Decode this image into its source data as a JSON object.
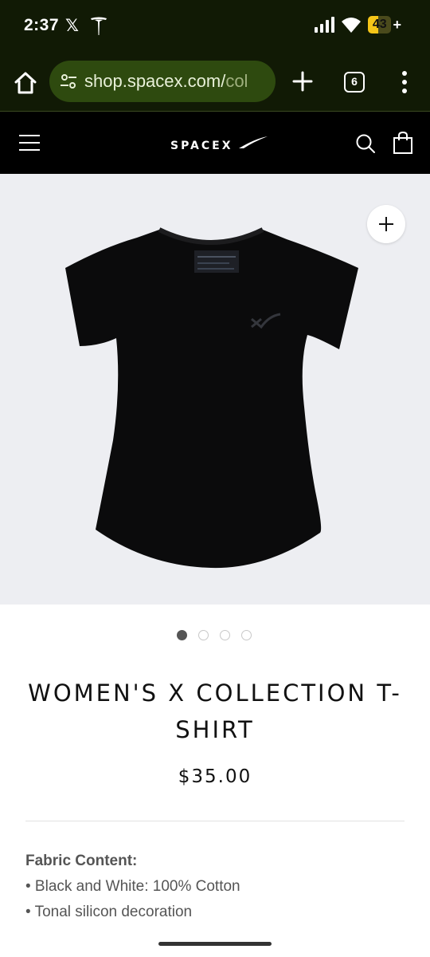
{
  "status_bar": {
    "time": "2:37",
    "x_glyph": "𝕏",
    "battery_level": "43",
    "battery_fill_percent": 43,
    "accent_color": "#f5c518"
  },
  "browser": {
    "url_main": "shop.spacex.com/",
    "url_rest": "col",
    "tab_count": "6",
    "bar_color": "#111a05",
    "pill_color": "#2e4a0f"
  },
  "site": {
    "logo_text": "SPACEX"
  },
  "product": {
    "title": "WOMEN'S X COLLECTION T-SHIRT",
    "price": "$35.00",
    "image_count": 4,
    "active_image": 1,
    "details_heading": "Fabric Content:",
    "details_items": [
      "• Black and White: 100% Cotton",
      "• Tonal silicon decoration"
    ]
  },
  "icons": [
    "home-icon",
    "tune-icon",
    "plus-icon",
    "tabs-icon",
    "more-vert-icon",
    "menu-icon",
    "search-icon",
    "shopping-bag-icon",
    "zoom-plus-icon"
  ]
}
